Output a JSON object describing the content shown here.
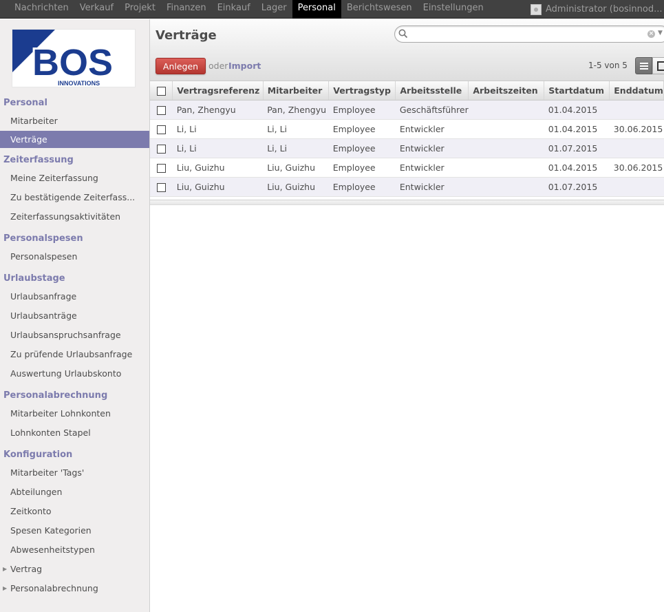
{
  "topmenu": {
    "items": [
      "Nachrichten",
      "Verkauf",
      "Projekt",
      "Finanzen",
      "Einkauf",
      "Lager",
      "Personal",
      "Berichtswesen",
      "Einstellungen"
    ],
    "active_index": 6
  },
  "user": {
    "name": "Administrator (bosinnod..."
  },
  "logo": {
    "main": "BOS",
    "sub": "INNOVATIONS",
    "color": "#1b3c8f"
  },
  "sidebar": {
    "sections": [
      {
        "title": "Personal",
        "items": [
          {
            "label": "Mitarbeiter"
          },
          {
            "label": "Verträge",
            "active": true
          }
        ]
      },
      {
        "title": "Zeiterfassung",
        "items": [
          {
            "label": "Meine Zeiterfassung"
          },
          {
            "label": "Zu bestätigende Zeiterfass..."
          },
          {
            "label": "Zeiterfassungsaktivitäten"
          }
        ]
      },
      {
        "title": "Personalspesen",
        "items": [
          {
            "label": "Personalspesen"
          }
        ]
      },
      {
        "title": "Urlaubstage",
        "items": [
          {
            "label": "Urlaubsanfrage"
          },
          {
            "label": "Urlaubsanträge"
          },
          {
            "label": "Urlaubsanspruchsanfrage"
          },
          {
            "label": "Zu prüfende Urlaubsanfrage"
          },
          {
            "label": "Auswertung Urlaubskonto"
          }
        ]
      },
      {
        "title": "Personalabrechnung",
        "items": [
          {
            "label": "Mitarbeiter Lohnkonten"
          },
          {
            "label": "Lohnkonten Stapel"
          }
        ]
      },
      {
        "title": "Konfiguration",
        "items": [
          {
            "label": "Mitarbeiter 'Tags'"
          },
          {
            "label": "Abteilungen"
          },
          {
            "label": "Zeitkonto"
          },
          {
            "label": "Spesen Kategorien"
          },
          {
            "label": "Abwesenheitstypen"
          },
          {
            "label": "Vertrag",
            "expandable": true
          },
          {
            "label": "Personalabrechnung",
            "expandable": true
          }
        ]
      }
    ]
  },
  "header": {
    "title": "Verträge",
    "search_placeholder": "",
    "create_label": "Anlegen",
    "or_label": "oder",
    "import_label": "Import",
    "pager": "1-5 von 5"
  },
  "table": {
    "columns": [
      "Vertragsreferenz",
      "Mitarbeiter",
      "Vertragstyp",
      "Arbeitsstelle",
      "Arbeitszeiten",
      "Startdatum",
      "Enddatum"
    ],
    "rows": [
      [
        "Pan, Zhengyu",
        "Pan, Zhengyu",
        "Employee",
        "Geschäftsführer",
        "",
        "01.04.2015",
        ""
      ],
      [
        "Li, Li",
        "Li, Li",
        "Employee",
        "Entwickler",
        "",
        "01.04.2015",
        "30.06.2015"
      ],
      [
        "Li, Li",
        "Li, Li",
        "Employee",
        "Entwickler",
        "",
        "01.07.2015",
        ""
      ],
      [
        "Liu, Guizhu",
        "Liu, Guizhu",
        "Employee",
        "Entwickler",
        "",
        "01.04.2015",
        "30.06.2015"
      ],
      [
        "Liu, Guizhu",
        "Liu, Guizhu",
        "Employee",
        "Entwickler",
        "",
        "01.07.2015",
        ""
      ]
    ]
  },
  "colors": {
    "accent": "#7c7bad",
    "create_button": "#c0433d",
    "topbar": "#414141"
  }
}
